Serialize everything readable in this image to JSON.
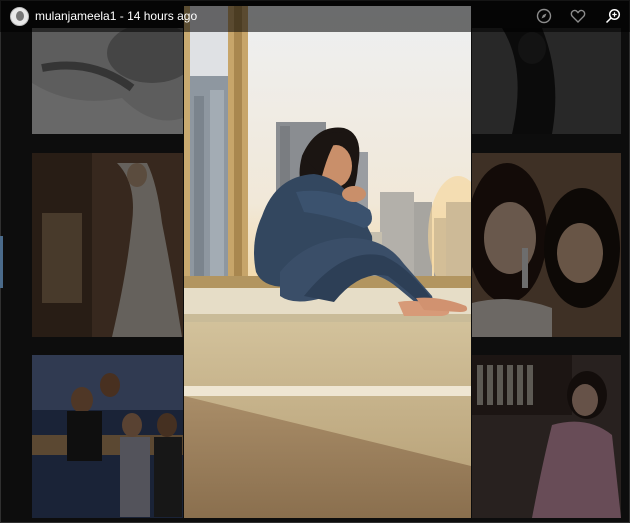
{
  "header": {
    "username": "mulanjameela1",
    "separator": "-",
    "timestamp": "14 hours ago",
    "avatar_icon": "profile-avatar",
    "icons": [
      "compass-icon",
      "heart-icon",
      "zoom-icon"
    ]
  },
  "colors": {
    "background": "#1d1d1d",
    "text": "#ffffff",
    "icon": "#8c8c8c"
  }
}
